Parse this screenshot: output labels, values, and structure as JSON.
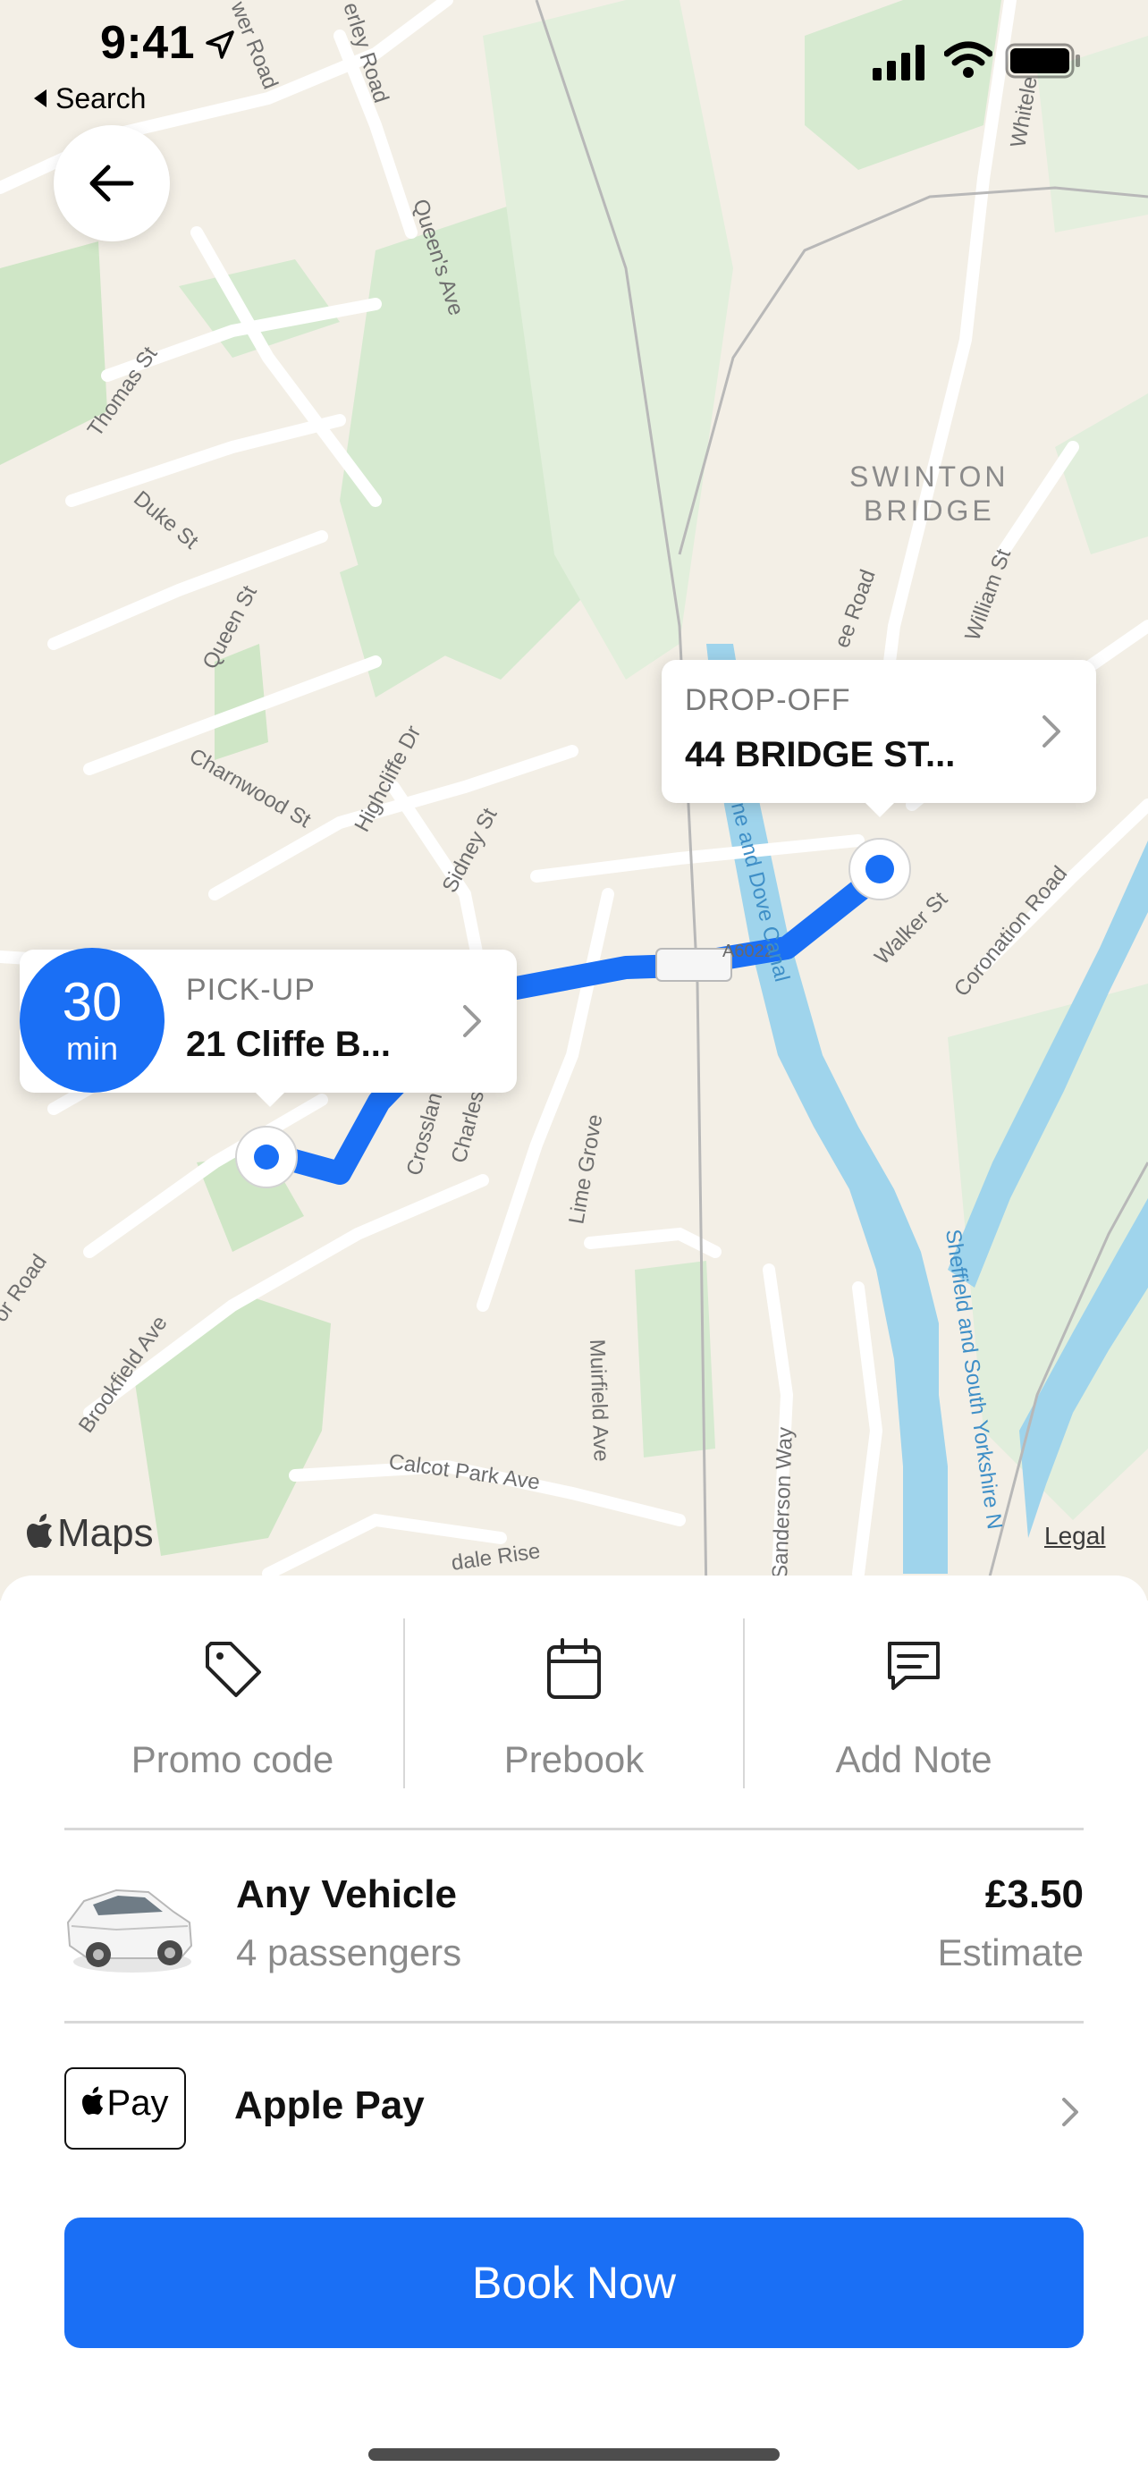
{
  "status_bar": {
    "time": "9:41",
    "back_to_app": "Search"
  },
  "map": {
    "street_labels": {
      "thomas_st": "Thomas St",
      "duke_st": "Duke St",
      "queen_st": "Queen St",
      "queens_ave": "Queen's Ave",
      "charnwood_st": "Charnwood St",
      "highcliffe_dr": "Highcliffe Dr",
      "sidney_st": "Sidney St",
      "area_swinton": "SWINTON",
      "area_bridge": "BRIDGE",
      "william_st": "William St",
      "walker_st": "Walker St",
      "coronation_road": "Coronation Road",
      "road_shield": "A6022",
      "canal": "rne and Dove Canal",
      "lime_grove": "Lime Grove",
      "crosslan": "Crosslan",
      "charles": "Charles",
      "brookfield_ave": "Brookfield Ave",
      "or_road": "or Road",
      "muirfield_ave": "Muirfield Ave",
      "calcot_park_ave": "Calcot Park Ave",
      "dale_rise": "dale Rise",
      "sanderson_way": "Sanderson Way",
      "sheffield_canal": "Sheffield and South Yorkshire N",
      "ee_road": "ee Road",
      "erley_road": "erley Road",
      "wer_road": "wer Road",
      "whiteley": "Whitele"
    },
    "maps_brand": "Maps",
    "legal": "Legal",
    "eta": {
      "value": "30",
      "unit": "min"
    },
    "pickup": {
      "label": "PICK-UP",
      "address": "21 Cliffe B..."
    },
    "dropoff": {
      "label": "DROP-OFF",
      "address": "44 BRIDGE ST..."
    },
    "colors": {
      "route": "#1a6ff5",
      "water": "#9fd4ec",
      "park": "#cfe6c6"
    }
  },
  "actions": [
    {
      "label": "Promo code",
      "icon": "tag-icon"
    },
    {
      "label": "Prebook",
      "icon": "calendar-icon"
    },
    {
      "label": "Add Note",
      "icon": "message-icon"
    }
  ],
  "vehicle": {
    "name": "Any Vehicle",
    "capacity": "4 passengers",
    "price": "£3.50",
    "price_note": "Estimate"
  },
  "payment": {
    "badge": "Pay",
    "label": "Apple Pay"
  },
  "book_button": "Book Now",
  "accent_color": "#1a6ff5"
}
